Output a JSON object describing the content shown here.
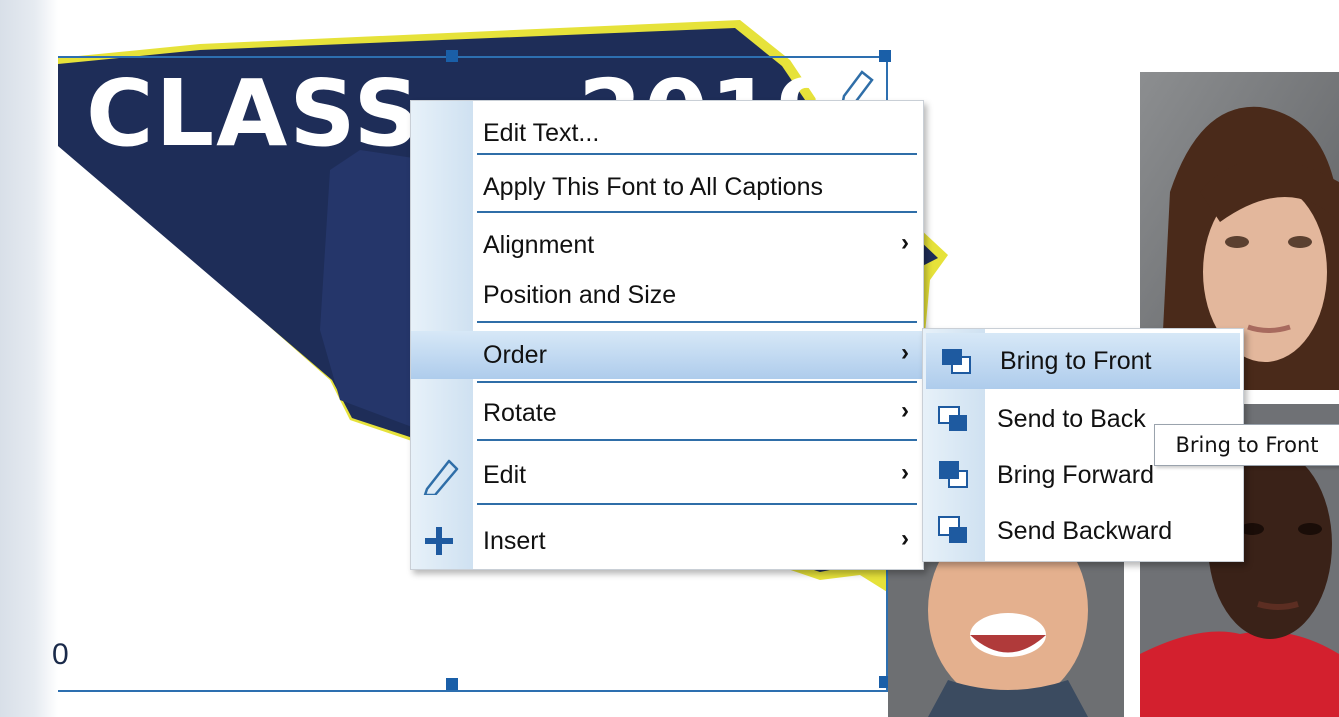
{
  "canvas": {
    "title_text": "CLASS",
    "year_text": "2019",
    "left_mark": "0"
  },
  "context_menu": {
    "items": [
      {
        "label": "Edit Text...",
        "has_submenu": false,
        "icon": ""
      },
      {
        "label": "Apply This Font to All Captions",
        "has_submenu": false,
        "icon": ""
      },
      {
        "label": "Alignment",
        "has_submenu": true,
        "icon": ""
      },
      {
        "label": "Position and Size",
        "has_submenu": false,
        "icon": ""
      },
      {
        "label": "Order",
        "has_submenu": true,
        "icon": "",
        "highlighted": true
      },
      {
        "label": "Rotate",
        "has_submenu": true,
        "icon": ""
      },
      {
        "label": "Edit",
        "has_submenu": true,
        "icon": "pencil-icon"
      },
      {
        "label": "Insert",
        "has_submenu": true,
        "icon": "plus-icon"
      }
    ],
    "submenu_arrow": "›"
  },
  "order_submenu": {
    "items": [
      {
        "label": "Bring to Front",
        "icon": "bring-to-front-icon",
        "highlighted": true
      },
      {
        "label": "Send to Back",
        "icon": "send-to-back-icon"
      },
      {
        "label": "Bring Forward",
        "icon": "bring-forward-icon"
      },
      {
        "label": "Send Backward",
        "icon": "send-backward-icon"
      }
    ]
  },
  "tooltip": {
    "text": "Bring to Front"
  },
  "colors": {
    "accent_blue": "#2f6ea8",
    "highlight_top": "#d7e8f7",
    "highlight_bottom": "#aeccec",
    "cap_navy": "#1e2d58",
    "cap_outline_yellow": "#e6e23a"
  }
}
